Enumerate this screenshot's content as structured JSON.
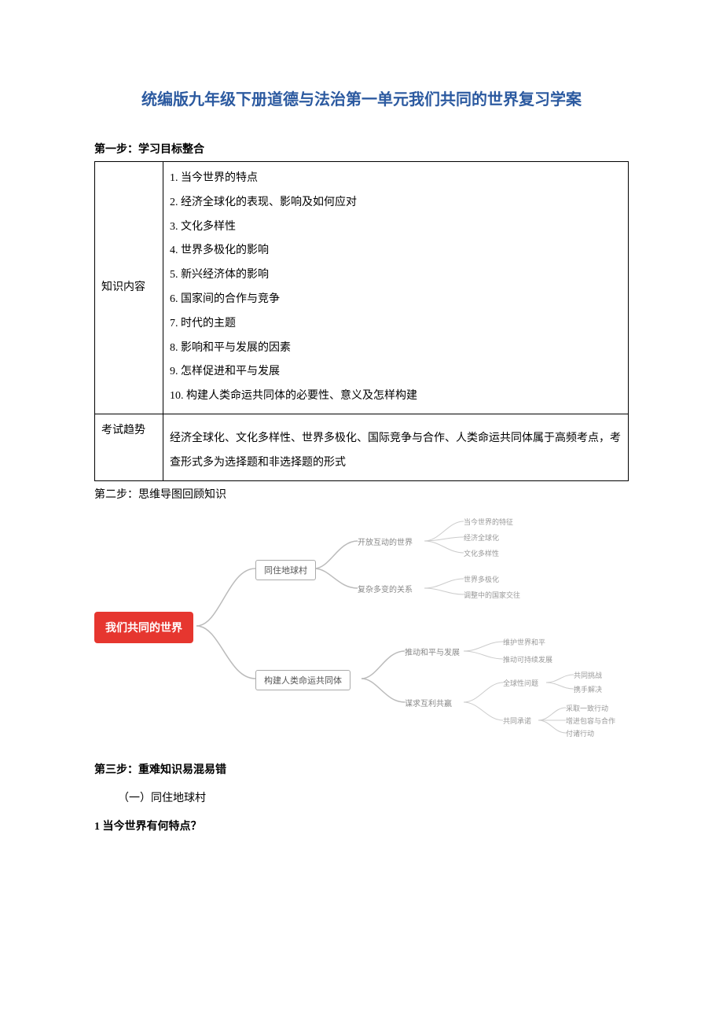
{
  "title": "统编版九年级下册道德与法治第一单元我们共同的世界复习学案",
  "step1_label": "第一步：学习目标整合",
  "table": {
    "row1_label": "知识内容",
    "row1_items": [
      "1. 当今世界的特点",
      "2. 经济全球化的表现、影响及如何应对",
      "3. 文化多样性",
      "4. 世界多极化的影响",
      "5. 新兴经济体的影响",
      "6. 国家间的合作与竞争",
      "7. 时代的主题",
      "8. 影响和平与发展的因素",
      "9. 怎样促进和平与发展",
      "10. 构建人类命运共同体的必要性、意义及怎样构建"
    ],
    "row2_label": "考试趋势",
    "row2_text": "经济全球化、文化多样性、世界多极化、国际竞争与合作、人类命运共同体属于高频考点，考查形式多为选择题和非选择题的形式"
  },
  "step2_label": "第二步：思维导图回顾知识",
  "mindmap": {
    "root": "我们共同的世界",
    "branch1": {
      "label": "同住地球村",
      "sub1": {
        "label": "开放互动的世界",
        "leaves": [
          "当今世界的特征",
          "经济全球化",
          "文化多样性"
        ]
      },
      "sub2": {
        "label": "复杂多变的关系",
        "leaves": [
          "世界多极化",
          "调整中的国家交往"
        ]
      }
    },
    "branch2": {
      "label": "构建人类命运共同体",
      "sub1": {
        "label": "推动和平与发展",
        "leaves": [
          "维护世界和平",
          "推动可持续发展"
        ]
      },
      "sub2": {
        "label": "谋求互利共赢",
        "sub_a": {
          "label": "全球性问题",
          "leaves": [
            "共同挑战",
            "携手解决"
          ]
        },
        "sub_b": {
          "label": "共同承诺",
          "leaves": [
            "采取一致行动",
            "增进包容与合作",
            "付诸行动"
          ]
        }
      }
    }
  },
  "step3_label": "第三步：重难知识易混易错",
  "sub_heading": "（一）同住地球村",
  "q1": "1 当今世界有何特点？"
}
